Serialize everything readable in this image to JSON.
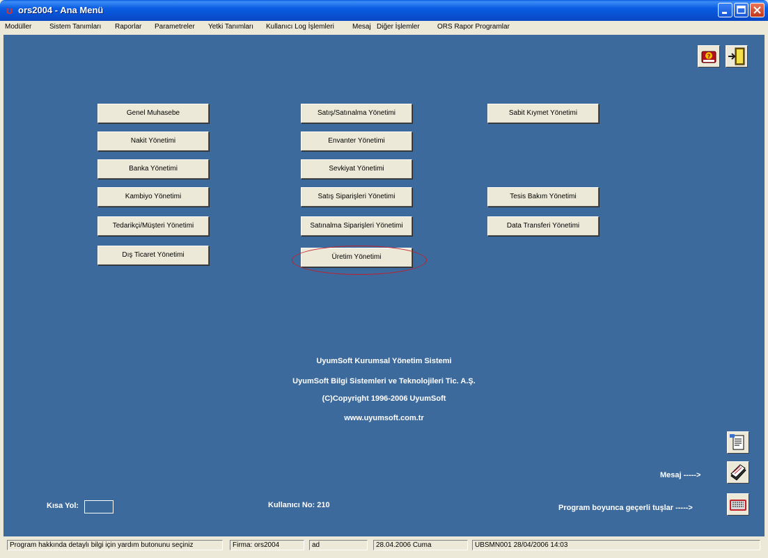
{
  "window": {
    "title": "ors2004 - Ana Menü"
  },
  "menu": [
    "Modüller",
    "Sistem Tanımları",
    "Raporlar",
    "Parametreler",
    "Yetki Tanımları",
    "Kullanıcı Log İşlemleri",
    "Mesaj",
    "Diğer İşlemler",
    "ORS Rapor Programlar"
  ],
  "modules": {
    "col1": [
      "Genel Muhasebe",
      "Nakit Yönetimi",
      "Banka Yönetimi",
      "Kambiyo Yönetimi",
      "Tedarikçi/Müşteri Yönetimi",
      "Dış Ticaret Yönetimi"
    ],
    "col2": [
      "Satış/Satınalma Yönetimi",
      "Envanter Yönetimi",
      "Sevkiyat Yönetimi",
      "Satış Siparişleri Yönetimi",
      "Satınalma Siparişleri Yönetimi",
      "Üretim Yönetimi"
    ],
    "col3": [
      "Sabit Kıymet Yönetimi",
      "Tesis Bakım Yönetimi",
      "Data Transferi Yönetimi"
    ]
  },
  "info": [
    "UyumSoft Kurumsal Yönetim Sistemi",
    "UyumSoft Bilgi Sistemleri ve Teknolojileri Tic. A.Ş.",
    "(C)Copyright  1996-2006 UyumSoft",
    "www.uyumsoft.com.tr"
  ],
  "labels": {
    "kisa_yol": "Kısa Yol:",
    "kullanici": "Kullanıcı No:  210",
    "mesaj": "Mesaj ----->",
    "tuslar": "Program boyunca geçerli tuşlar ----->"
  },
  "status": [
    "Program hakkında detaylı bilgi için yardım butonunu seçiniz",
    "Firma: ors2004",
    "ad",
    "28.04.2006  Cuma",
    "UBSMN001 28/04/2006 14:03"
  ],
  "icons": {
    "app": "app-logo-icon",
    "help": "help-book-icon",
    "exit": "exit-door-icon",
    "report": "report-document-icon",
    "message": "message-stack-icon",
    "keyboard": "keyboard-icon"
  },
  "colors": {
    "desktop": "#3D6A9C",
    "titlebar": "#0A5DE2",
    "highlight_ring": "#C0202A",
    "face": "#ECE9D8"
  }
}
